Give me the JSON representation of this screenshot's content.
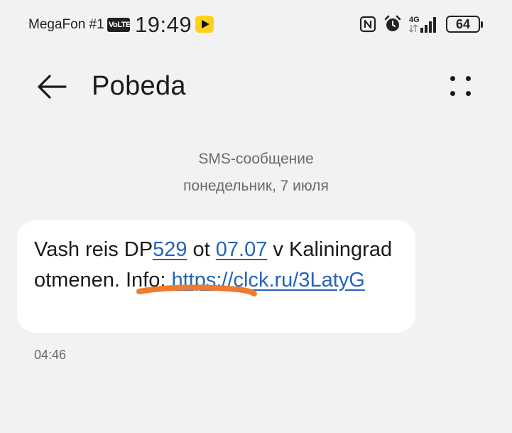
{
  "status_bar": {
    "carrier": "MegaFon #1",
    "volte": "VoLTE",
    "time": "19:49",
    "network": "4G",
    "battery": "64"
  },
  "header": {
    "title": "Pobeda"
  },
  "conversation": {
    "message_type": "SMS-сообщение",
    "date": "понедельник, 7 июля"
  },
  "message": {
    "text_1": "Vash reis DP",
    "link_flight": "529",
    "text_2": " ot ",
    "link_date": "07.07",
    "text_3": " v Kaliningrad otmenen. Info: ",
    "link_url": "https://clck.ru/3LatyG",
    "time": "04:46"
  },
  "colors": {
    "link": "#2563b8",
    "markup_stroke": "#f07b2e",
    "bubble": "#ffffff",
    "background": "#f2f2f4"
  }
}
